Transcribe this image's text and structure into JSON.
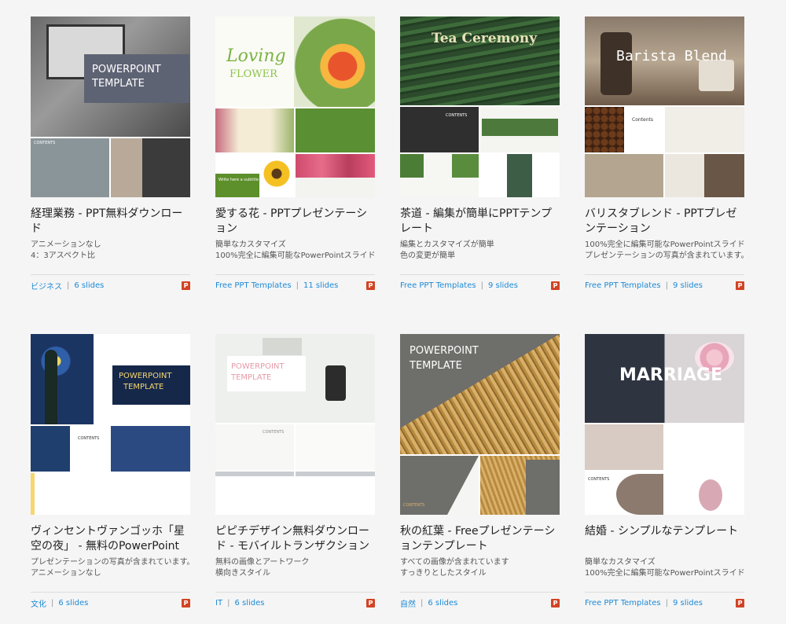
{
  "cards": [
    {
      "title": "経理業務 - PPT無料ダウンロード",
      "desc": [
        "アニメーションなし",
        "4：3アスペクト比"
      ],
      "category": "ビジネス",
      "slides": "6 slides",
      "thumb_text": {
        "line1": "POWERPOINT",
        "line2": "TEMPLATE",
        "small": "CONTENTS"
      }
    },
    {
      "title": "愛する花 - PPTプレゼンテーション",
      "desc": [
        "簡単なカスタマイズ",
        "100%完全に編集可能なPowerPointスライド"
      ],
      "category": "Free PPT Templates",
      "slides": "11 slides",
      "thumb_text": {
        "line1": "Loving",
        "line2": "FLOWER",
        "small": "Write here a subtitle"
      }
    },
    {
      "title": "茶道 - 編集が簡単にPPTテンプレート",
      "desc": [
        "編集とカスタマイズが簡単",
        "色の変更が簡単"
      ],
      "category": "Free PPT Templates",
      "slides": "9 slides",
      "thumb_text": {
        "line1": "Tea Ceremony",
        "line2": "",
        "small": "CONTENTS"
      }
    },
    {
      "title": "バリスタブレンド - PPTプレゼンテーション",
      "desc": [
        "100%完全に編集可能なPowerPointスライド",
        "プレゼンテーションの写真が含まれています。"
      ],
      "category": "Free PPT Templates",
      "slides": "9 slides",
      "thumb_text": {
        "line1": "Barista Blend",
        "line2": "",
        "small": "Contents"
      }
    },
    {
      "title": "ヴィンセントヴァンゴッホ「星空の夜」 - 無料のPowerPointテンプ",
      "desc": [
        "プレゼンテーションの写真が含まれています。",
        "アニメーションなし"
      ],
      "category": "文化",
      "slides": "6 slides",
      "thumb_text": {
        "line1": "POWERPOINT",
        "line2": "TEMPLATE",
        "small": "CONTENTS"
      }
    },
    {
      "title": "ピピチデザイン無料ダウンロード - モバイルトランザクション請求",
      "desc": [
        "無料の画像とアートワーク",
        "横向きスタイル"
      ],
      "category": "IT",
      "slides": "6 slides",
      "thumb_text": {
        "line1": "POWERPOINT",
        "line2": "TEMPLATE",
        "small": "CONTENTS"
      }
    },
    {
      "title": "秋の紅葉 - Freeプレゼンテーションテンプレート",
      "desc": [
        "すべての画像が含まれています",
        "すっきりとしたスタイル"
      ],
      "category": "自然",
      "slides": "6 slides",
      "thumb_text": {
        "line1": "POWERPOINT",
        "line2": "TEMPLATE",
        "small": "CONTENTS"
      }
    },
    {
      "title": "結婚 - シンプルなテンプレート",
      "desc": [
        "簡単なカスタマイズ",
        "100%完全に編集可能なPowerPointスライド"
      ],
      "category": "Free PPT Templates",
      "slides": "9 slides",
      "thumb_text": {
        "line1": "MARRIAGE",
        "line2": "",
        "small": "CONTENTS"
      }
    }
  ],
  "ppt_badge": "P",
  "separator": "|",
  "colors": {
    "link": "#1d8ad6",
    "badge": "#d14424",
    "background": "#f5f5f5"
  }
}
